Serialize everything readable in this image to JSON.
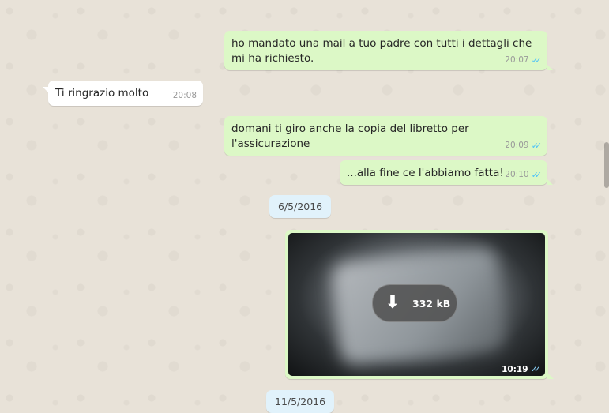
{
  "messages": [
    {
      "text": "ho mandato una mail a tuo padre con tutti i dettagli che mi ha richiesto.",
      "time": "20:07"
    },
    {
      "text": "Ti ringrazio molto",
      "time": "20:08"
    },
    {
      "text": "domani ti giro anche la copia del libretto per l'assicurazione",
      "time": "20:09"
    },
    {
      "text": "...alla fine ce l'abbiamo fatta!",
      "time": "20:10"
    }
  ],
  "dates": [
    "6/5/2016",
    "11/5/2016"
  ],
  "media": {
    "size": "332 kB",
    "time": "10:19",
    "icon": "download-icon"
  },
  "ticks": "✓✓",
  "colors": {
    "outgoing": "#dcf8c6",
    "incoming": "#ffffff",
    "read_ticks": "#4fc3f7",
    "date_chip": "#e1f2fb"
  }
}
